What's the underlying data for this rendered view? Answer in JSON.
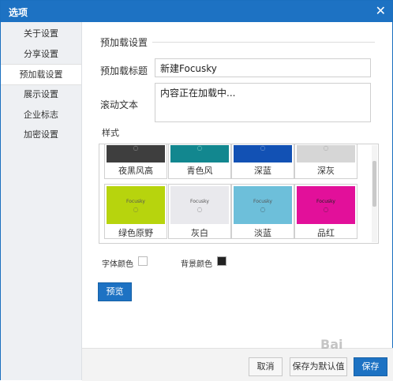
{
  "window": {
    "title": "选项",
    "close_glyph": "✕"
  },
  "sidebar": {
    "items": [
      {
        "label": "关于设置"
      },
      {
        "label": "分享设置"
      },
      {
        "label": "预加载设置",
        "active": true
      },
      {
        "label": "展示设置"
      },
      {
        "label": "企业标志"
      },
      {
        "label": "加密设置"
      }
    ]
  },
  "preload": {
    "section_title": "预加载设置",
    "title_label": "预加载标题",
    "title_value": "新建Focusky",
    "scroll_label": "滚动文本",
    "scroll_value": "内容正在加载中...",
    "style_label": "样式"
  },
  "styles": [
    {
      "name": "夜黑风高",
      "color": "#3e3e3e"
    },
    {
      "name": "青色风",
      "color": "#12878f"
    },
    {
      "name": "深蓝",
      "color": "#1251b4"
    },
    {
      "name": "深灰",
      "color": "#d6d6d6"
    },
    {
      "name": "绿色原野",
      "color": "#b7d40d",
      "brand": "Focusky"
    },
    {
      "name": "灰白",
      "color": "#e9e9ed",
      "brand": "Focusky"
    },
    {
      "name": "淡蓝",
      "color": "#6dbfda",
      "brand": "Focusky"
    },
    {
      "name": "品红",
      "color": "#e2109a",
      "brand": "Focusky"
    }
  ],
  "colors": {
    "font_label": "字体颜色",
    "font_color": "#ffffff",
    "bg_label": "背景颜色",
    "bg_color": "#222222"
  },
  "buttons": {
    "preview": "预览",
    "cancel": "取消",
    "save_default": "保存为默认值",
    "save": "保存"
  },
  "watermark": "Bai"
}
